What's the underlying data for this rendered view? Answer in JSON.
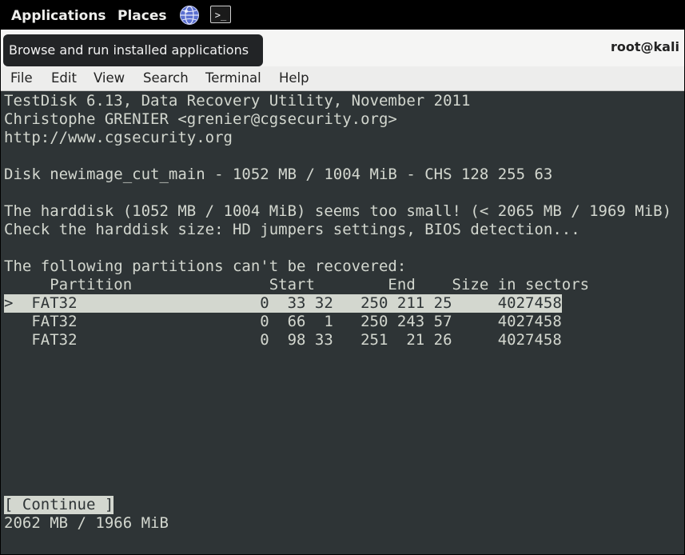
{
  "topbar": {
    "applications": "Applications",
    "places": "Places",
    "terminal_glyph": ">_",
    "icons": [
      "globe-icon",
      "terminal-launcher-icon"
    ]
  },
  "window": {
    "title": "root@kali",
    "tooltip": "Browse and run installed applications"
  },
  "menu": [
    "File",
    "Edit",
    "View",
    "Search",
    "Terminal",
    "Help"
  ],
  "terminal": {
    "header_lines": [
      "TestDisk 6.13, Data Recovery Utility, November 2011",
      "Christophe GRENIER <grenier@cgsecurity.org>",
      "http://www.cgsecurity.org"
    ],
    "disk_line": "Disk newimage_cut_main - 1052 MB / 1004 MiB - CHS 128 255 63",
    "warning_lines": [
      "The harddisk (1052 MB / 1004 MiB) seems too small! (< 2065 MB / 1969 MiB)",
      "Check the harddisk size: HD jumpers settings, BIOS detection..."
    ],
    "partitions_heading": "The following partitions can't be recovered:",
    "columns_header": "     Partition               Start        End    Size in sectors",
    "rows": [
      ">  FAT32                    0  33 32   250 211 25     4027458",
      "   FAT32                    0  66  1   250 243 57     4027458",
      "   FAT32                    0  98 33   251  21 26     4027458"
    ],
    "continue_button": "[ Continue ]",
    "status_line": "2062 MB / 1966 MiB"
  },
  "colors": {
    "terminal_bg": "#2e3436",
    "terminal_fg": "#d3d7cf",
    "highlight_bg": "#d3d7cf",
    "topbar_bg": "#000000"
  }
}
